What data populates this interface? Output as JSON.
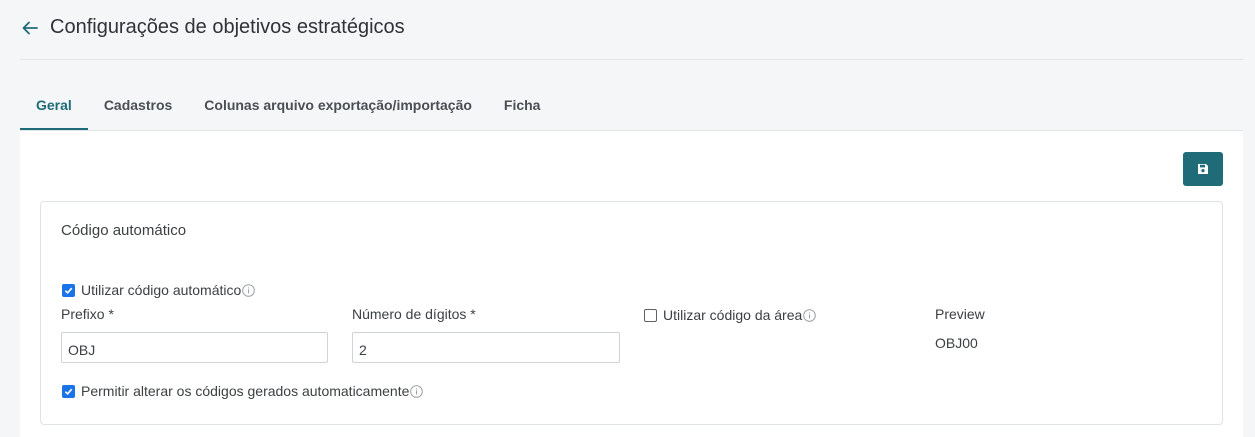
{
  "header": {
    "title": "Configurações de objetivos estratégicos",
    "back_icon": "arrow-left-icon"
  },
  "tabs": [
    {
      "label": "Geral",
      "active": true
    },
    {
      "label": "Cadastros",
      "active": false
    },
    {
      "label": "Colunas arquivo exportação/importação",
      "active": false
    },
    {
      "label": "Ficha",
      "active": false
    }
  ],
  "toolbar": {
    "save_icon": "floppy-disk-icon",
    "accent_color": "#1f6b77"
  },
  "card": {
    "title": "Código automático",
    "use_auto_code": {
      "label": "Utilizar código automático",
      "checked": true
    },
    "prefix": {
      "label": "Prefixo *",
      "value": "OBJ"
    },
    "digits": {
      "label": "Número de dígitos *",
      "value": "2"
    },
    "use_area_code": {
      "label": "Utilizar código da área",
      "checked": false
    },
    "preview": {
      "label": "Preview",
      "value": "OBJ00"
    },
    "allow_change": {
      "label": "Permitir alterar os códigos gerados automaticamente",
      "checked": true
    }
  }
}
